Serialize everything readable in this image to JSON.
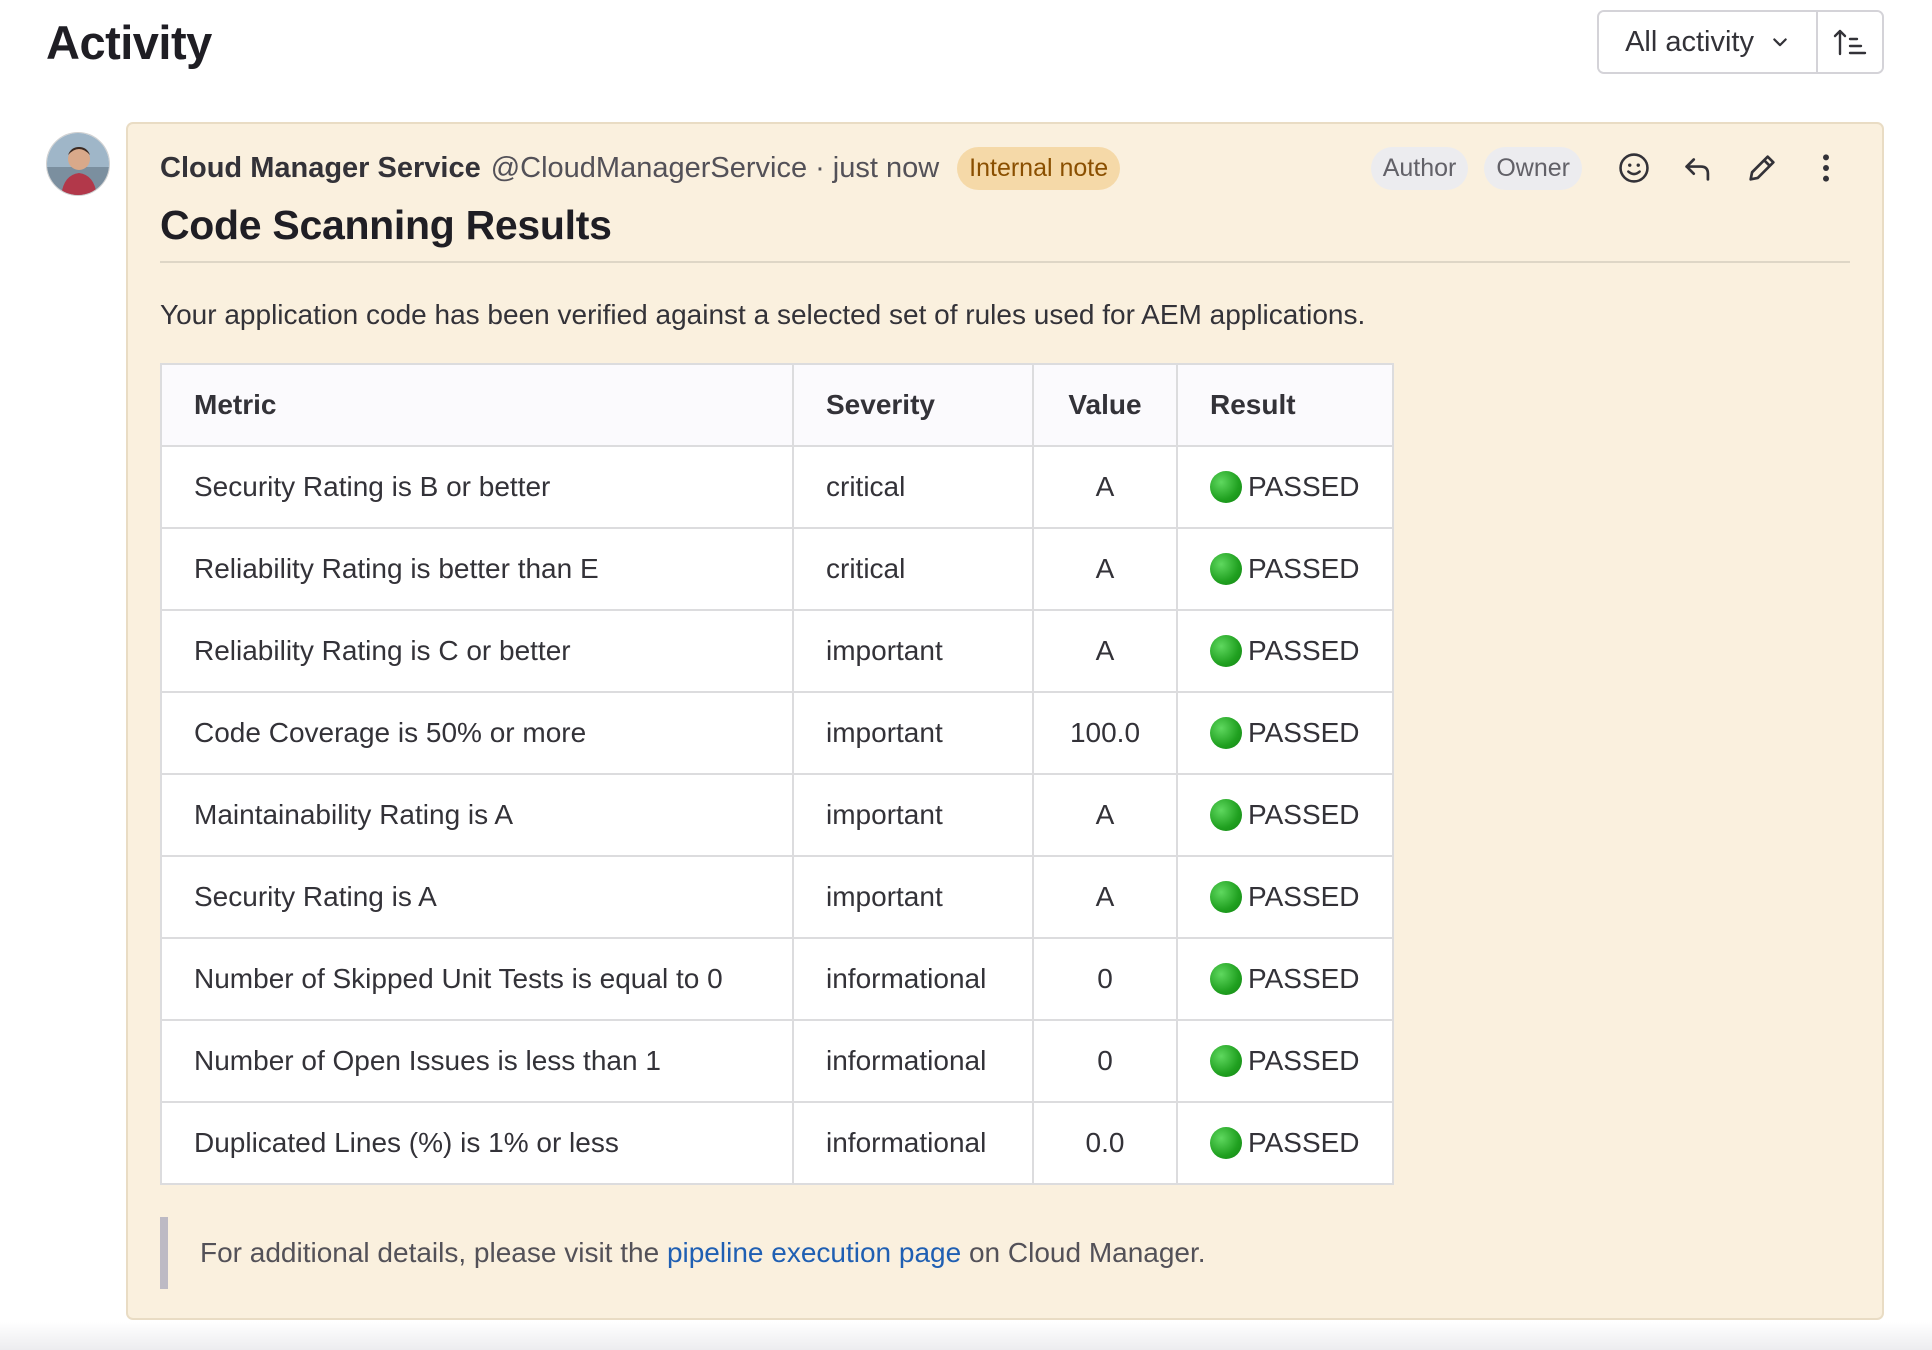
{
  "header": {
    "title": "Activity",
    "filter_label": "All activity"
  },
  "note": {
    "author_name": "Cloud Manager Service",
    "author_handle": "@CloudManagerService",
    "separator": "·",
    "time": "just now",
    "internal_badge": "Internal note",
    "role_author": "Author",
    "role_owner": "Owner",
    "title": "Code Scanning Results",
    "intro": "Your application code has been verified against a selected set of rules used for AEM applications.",
    "table": {
      "headers": [
        "Metric",
        "Severity",
        "Value",
        "Result"
      ],
      "rows": [
        {
          "metric": "Security Rating is B or better",
          "severity": "critical",
          "value": "A",
          "result": "PASSED"
        },
        {
          "metric": "Reliability Rating is better than E",
          "severity": "critical",
          "value": "A",
          "result": "PASSED"
        },
        {
          "metric": "Reliability Rating is C or better",
          "severity": "important",
          "value": "A",
          "result": "PASSED"
        },
        {
          "metric": "Code Coverage is 50% or more",
          "severity": "important",
          "value": "100.0",
          "result": "PASSED"
        },
        {
          "metric": "Maintainability Rating is A",
          "severity": "important",
          "value": "A",
          "result": "PASSED"
        },
        {
          "metric": "Security Rating is A",
          "severity": "important",
          "value": "A",
          "result": "PASSED"
        },
        {
          "metric": "Number of Skipped Unit Tests is equal to 0",
          "severity": "informational",
          "value": "0",
          "result": "PASSED"
        },
        {
          "metric": "Number of Open Issues is less than 1",
          "severity": "informational",
          "value": "0",
          "result": "PASSED"
        },
        {
          "metric": "Duplicated Lines (%) is 1% or less",
          "severity": "informational",
          "value": "0.0",
          "result": "PASSED"
        }
      ]
    },
    "footer": {
      "prefix": "For additional details, please visit the",
      "link_text": "pipeline execution page",
      "suffix": "on Cloud Manager."
    }
  },
  "icons": {
    "filter_chevron": "chevron-down-icon",
    "sort": "sort-ascending-icon",
    "emoji": "smiley-icon",
    "reply": "reply-icon",
    "edit": "pencil-icon",
    "more": "kebab-menu-icon",
    "result_status": "green-circle-icon"
  },
  "colors": {
    "note_background": "#faf0de",
    "internal_badge_bg": "#f5d9a8",
    "internal_badge_text": "#8a4f00",
    "link": "#1f5fb3",
    "passed": "#20a020"
  }
}
